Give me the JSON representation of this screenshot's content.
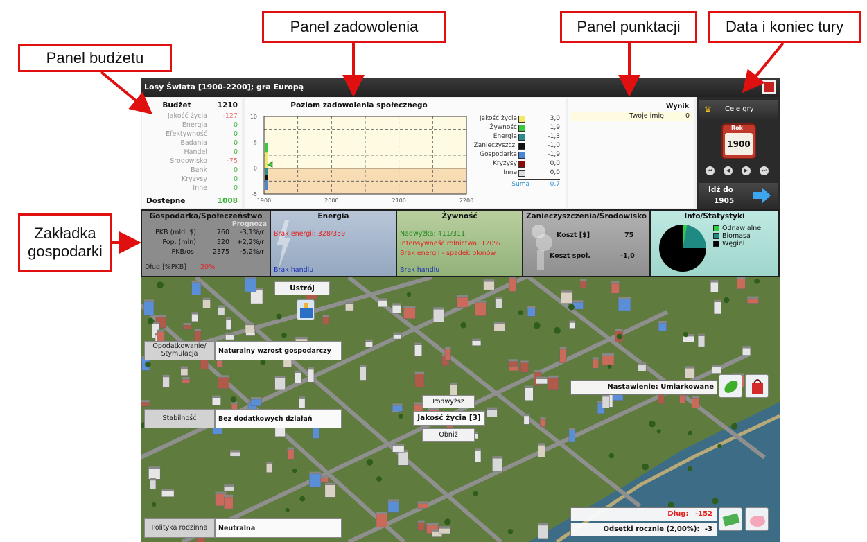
{
  "callouts": {
    "budget": "Panel budżetu",
    "satisfaction": "Panel zadowolenia",
    "score": "Panel punktacji",
    "date": "Data i koniec tury",
    "economy_line1": "Zakładka",
    "economy_line2": "gospodarki"
  },
  "window": {
    "title": "Losy Świata [1900-2200]; gra Europą"
  },
  "budget": {
    "header_label": "Budżet",
    "header_value": "1210",
    "items": [
      {
        "label": "Jakość życia",
        "value": "-127",
        "tone": "neg"
      },
      {
        "label": "Energia",
        "value": "0",
        "tone": "pos"
      },
      {
        "label": "Efektywność",
        "value": "0",
        "tone": "pos"
      },
      {
        "label": "Badania",
        "value": "0",
        "tone": "pos"
      },
      {
        "label": "Handel",
        "value": "0",
        "tone": "pos"
      },
      {
        "label": "Środowisko",
        "value": "-75",
        "tone": "neg"
      },
      {
        "label": "Bank",
        "value": "0",
        "tone": "pos"
      },
      {
        "label": "Kryzysy",
        "value": "0",
        "tone": "pos"
      },
      {
        "label": "Inne",
        "value": "0",
        "tone": "pos"
      }
    ],
    "footer_label": "Dostępne",
    "footer_value": "1008"
  },
  "satisfaction": {
    "title": "Poziom zadowolenia społecznego",
    "legend": [
      {
        "label": "Jakość życia",
        "value": "3,0",
        "color": "#f3e86a"
      },
      {
        "label": "Żywność",
        "value": "1,9",
        "color": "#3cc83c"
      },
      {
        "label": "Energia",
        "value": "-1,3",
        "color": "#2a8c8c"
      },
      {
        "label": "Zanieczyszcz.",
        "value": "-1,0",
        "color": "#111111"
      },
      {
        "label": "Gospodarka",
        "value": "-1,9",
        "color": "#4a86d6"
      },
      {
        "label": "Kryzysy",
        "value": "0,0",
        "color": "#8b0a0a"
      },
      {
        "label": "Inne",
        "value": "0,0",
        "color": "#dddddd"
      }
    ],
    "sum_label": "Suma",
    "sum_value": "0,7"
  },
  "chart_data": {
    "type": "bar",
    "title": "Poziom zadowolenia społecznego",
    "xlim": [
      1900,
      2200
    ],
    "ylim": [
      -5,
      10
    ],
    "x_ticks": [
      "1900",
      "2000",
      "2100",
      "2200"
    ],
    "y_ticks": [
      "10",
      "5",
      "0",
      "-5"
    ],
    "grid": true,
    "x": [
      1900
    ],
    "series": [
      {
        "name": "Jakość życia",
        "values": [
          3.0
        ],
        "color": "#f3e86a"
      },
      {
        "name": "Żywność",
        "values": [
          1.9
        ],
        "color": "#3cc83c"
      },
      {
        "name": "Energia",
        "values": [
          -1.3
        ],
        "color": "#2a8c8c"
      },
      {
        "name": "Zanieczyszcz.",
        "values": [
          -1.0
        ],
        "color": "#111111"
      },
      {
        "name": "Gospodarka",
        "values": [
          -1.9
        ],
        "color": "#4a86d6"
      },
      {
        "name": "Kryzysy",
        "values": [
          0.0
        ],
        "color": "#8b0a0a"
      },
      {
        "name": "Inne",
        "values": [
          0.0
        ],
        "color": "#dddddd"
      }
    ],
    "sum": {
      "name": "Suma",
      "values": [
        0.7
      ],
      "color": "#3cc83c"
    }
  },
  "score": {
    "title": "Wynik",
    "player_name": "Twoje imię",
    "player_score": "0"
  },
  "date": {
    "goals_label": "Cele gry",
    "calendar_tag": "Rok",
    "year": "1900",
    "next_turn_label": "Idź do",
    "next_turn_year": "1905"
  },
  "tabs": {
    "economy": {
      "title": "Gospodarka/Społeczeństwo",
      "forecast_header": "Prognoza",
      "rows": [
        {
          "label": "PKB (mld. $)",
          "value": "760",
          "forecast": "-3,1%/r"
        },
        {
          "label": "Pop. (mln)",
          "value": "320",
          "forecast": "+2,2%/r"
        },
        {
          "label": "PKB/os.",
          "value": "2375",
          "forecast": "-5,2%/r"
        }
      ],
      "debt_label": "Dług [%PKB]",
      "debt_value": "20%"
    },
    "energy": {
      "title": "Energia",
      "shortage": "Brak energii: 328/359",
      "trade": "Brak handlu"
    },
    "food": {
      "title": "Żywność",
      "surplus": "Nadwyżka: 411/311",
      "intensity": "Intensywność rolnictwa: 120%",
      "shortage": "Brak energii - spadek plonów",
      "trade": "Brak handlu"
    },
    "pollution": {
      "title": "Zanieczyszczenia/Środowisko",
      "cost_label": "Koszt [$]",
      "cost_value": "75",
      "social_label": "Koszt społ.",
      "social_value": "-1,0"
    },
    "info": {
      "title": "Info/Statystyki",
      "pie": [
        {
          "label": "Odnawialne",
          "value": 0.03,
          "color": "#2ecc40"
        },
        {
          "label": "Biomasa",
          "value": 0.22,
          "color": "#1f8a82"
        },
        {
          "label": "Węgiel",
          "value": 0.75,
          "color": "#000000"
        }
      ]
    }
  },
  "map": {
    "system_button": "Ustrój",
    "policies": [
      {
        "key": "Opodatkowanie/ Stymulacja",
        "value": "Naturalny wzrost gospodarczy"
      },
      {
        "key": "Stabilność",
        "value": "Bez dodatkowych działań"
      },
      {
        "key": "Polityka rodzinna",
        "value": "Neutralna"
      }
    ],
    "quality": {
      "raise": "Podwyższ",
      "label": "Jakość życia [3]",
      "lower": "Obniż"
    },
    "attitude": "Nastawienie: Umiarkowane",
    "debt_label": "Dług:",
    "debt_value": "-152",
    "interest_label": "Odsetki rocznie (2,00%):",
    "interest_value": "-3"
  },
  "colors": {
    "callout_border": "#e01010",
    "accent_negative": "#e32020",
    "accent_positive": "#38b038"
  }
}
